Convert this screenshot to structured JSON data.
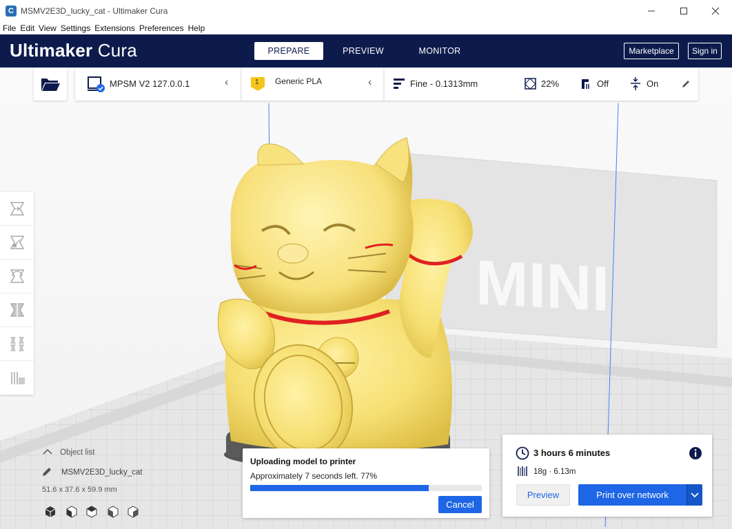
{
  "window": {
    "title": "MSMV2E3D_lucky_cat - Ultimaker Cura",
    "app_icon_glyph": "C",
    "controls": [
      "minimize",
      "maximize",
      "close"
    ]
  },
  "menu": [
    "File",
    "Edit",
    "View",
    "Settings",
    "Extensions",
    "Preferences",
    "Help"
  ],
  "header": {
    "brand_bold": "Ultimaker",
    "brand_light": "Cura",
    "stages": [
      {
        "label": "PREPARE",
        "active": true
      },
      {
        "label": "PREVIEW",
        "active": false
      },
      {
        "label": "MONITOR",
        "active": false
      }
    ],
    "marketplace": "Marketplace",
    "sign_in": "Sign in",
    "bg_color": "#0d1b4c"
  },
  "toolbar": {
    "printer": "MPSM V2 127.0.0.1",
    "material_badge": "1",
    "material": "Generic PLA",
    "profile": "Fine - 0.1313mm",
    "infill": "22%",
    "support": "Off",
    "adhesion": "On"
  },
  "scene": {
    "backplate_text": "MINI",
    "model_color": "#f6e17a"
  },
  "object_list": {
    "toggle_label": "Object list",
    "object_name": "MSMV2E3D_lucky_cat",
    "dimensions": "51.6 x 37.6 x 59.9 mm"
  },
  "upload": {
    "title": "Uploading model to printer",
    "status": "Approximately 7 seconds left. 77%",
    "progress": 0.77,
    "cancel": "Cancel"
  },
  "action": {
    "print_time": "3 hours 6 minutes",
    "material_estimate": "18g · 6.13m",
    "preview": "Preview",
    "print": "Print over network"
  },
  "colors": {
    "accent": "#1e66e5",
    "material_badge": "#f5c518"
  }
}
